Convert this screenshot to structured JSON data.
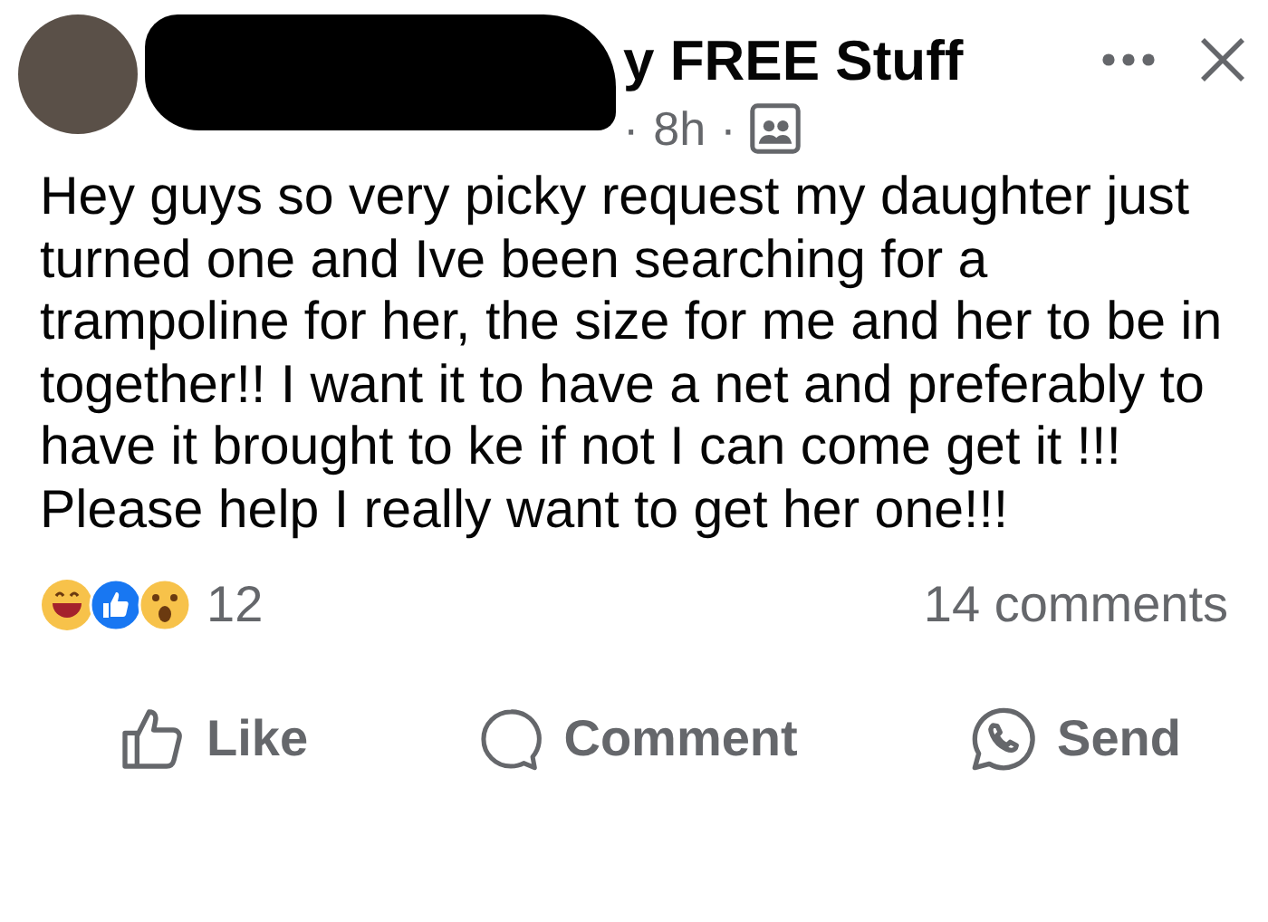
{
  "post": {
    "group_name": "y FREE Stuff",
    "time": "8h",
    "separator": "·",
    "text": "Hey guys so very picky request my daughter just turned one and Ive been searching for a trampoline for her, the size for me and her to be in together!! I want it to have a net and preferably to have it brought to ke if not I can come get it !!! Please help I really want to get her one!!!",
    "reaction_count": "12",
    "comment_count": "14 comments"
  },
  "actions": [
    {
      "kind": "like",
      "label": "Like"
    },
    {
      "kind": "comment",
      "label": "Comment"
    },
    {
      "kind": "send",
      "label": "Send"
    }
  ]
}
